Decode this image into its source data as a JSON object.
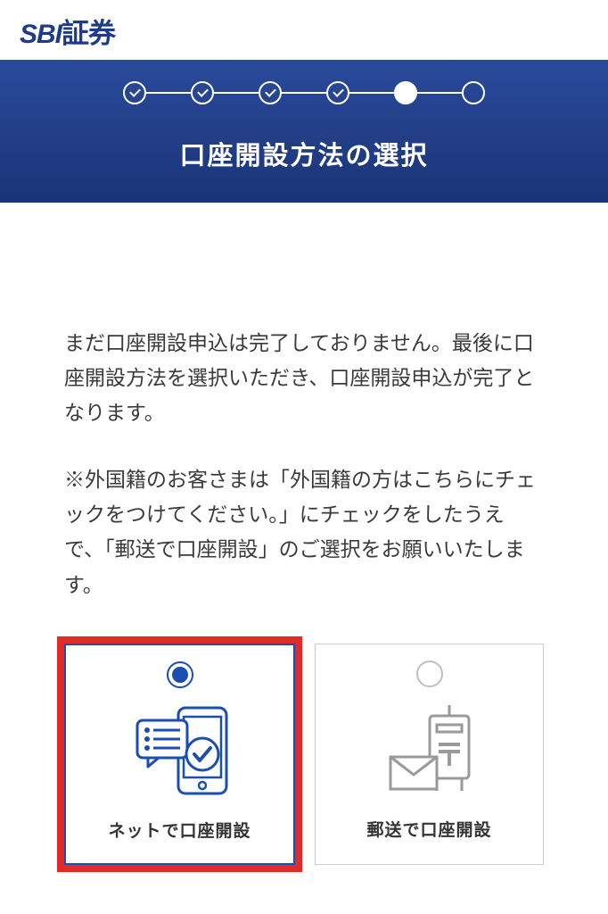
{
  "brand": {
    "logo_en": "SBI",
    "logo_jp": "証券"
  },
  "hero": {
    "title": "口座開設方法の選択"
  },
  "body": {
    "paragraph1": "まだ口座開設申込は完了しておりません。最後に口座開設方法を選択いただき、口座開設申込が完了となります。",
    "paragraph2": "※外国籍のお客さまは「外国籍の方はこちらにチェックをつけてください。」にチェックをしたうえで、「郵送で口座開設」のご選択をお願いいたします。"
  },
  "options": {
    "net": {
      "label": "ネットで口座開設",
      "selected": true
    },
    "mail": {
      "label": "郵送で口座開設",
      "selected": false
    }
  },
  "stepper": {
    "total": 6,
    "checked": 4,
    "current_index": 4
  }
}
